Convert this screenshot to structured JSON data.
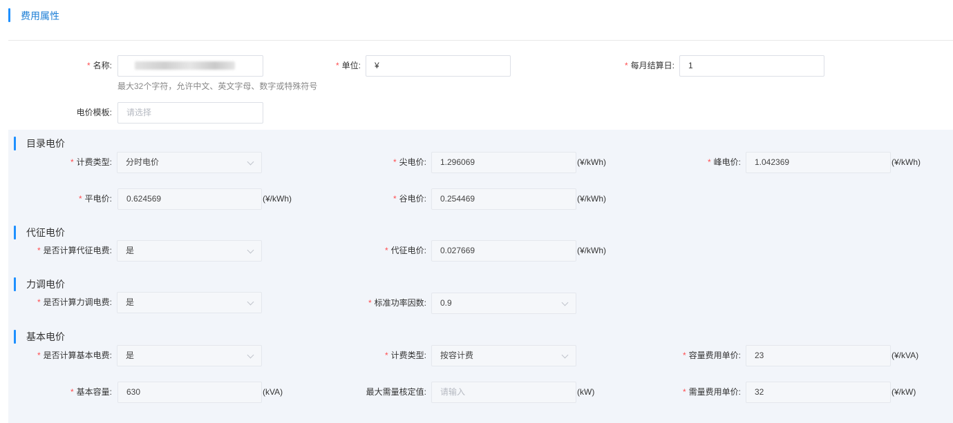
{
  "page": {
    "title": "费用属性"
  },
  "basic": {
    "name_label": "名称:",
    "name_value": "",
    "name_hint": "最大32个字符，允许中文、英文字母、数字或特殊符号",
    "unit_label": "单位:",
    "unit_value": "¥",
    "settle_label": "每月结算日:",
    "settle_value": "1",
    "template_label": "电价模板:",
    "template_placeholder": "请选择"
  },
  "catalog": {
    "title": "目录电价",
    "billing_type_label": "计费类型:",
    "billing_type_value": "分时电价",
    "sharp_label": "尖电价:",
    "sharp_value": "1.296069",
    "sharp_unit": "(¥/kWh)",
    "peak_label": "峰电价:",
    "peak_value": "1.042369",
    "peak_unit": "(¥/kWh)",
    "flat_label": "平电价:",
    "flat_value": "0.624569",
    "flat_unit": "(¥/kWh)",
    "valley_label": "谷电价:",
    "valley_value": "0.254469",
    "valley_unit": "(¥/kWh)"
  },
  "surcharge": {
    "title": "代征电价",
    "calc_label": "是否计算代征电费:",
    "calc_value": "是",
    "price_label": "代征电价:",
    "price_value": "0.027669",
    "price_unit": "(¥/kWh)"
  },
  "power_factor": {
    "title": "力调电价",
    "calc_label": "是否计算力调电费:",
    "calc_value": "是",
    "std_label": "标准功率因数:",
    "std_value": "0.9"
  },
  "basic_price": {
    "title": "基本电价",
    "calc_label": "是否计算基本电费:",
    "calc_value": "是",
    "type_label": "计费类型:",
    "type_value": "按容计费",
    "cap_price_label": "容量费用单价:",
    "cap_price_value": "23",
    "cap_price_unit": "(¥/kVA)",
    "base_cap_label": "基本容量:",
    "base_cap_value": "630",
    "base_cap_unit": "(kVA)",
    "max_demand_label": "最大需量核定值:",
    "max_demand_placeholder": "请输入",
    "max_demand_unit": "(kW)",
    "demand_price_label": "需量费用单价:",
    "demand_price_value": "32",
    "demand_price_unit": "(¥/kW)"
  }
}
